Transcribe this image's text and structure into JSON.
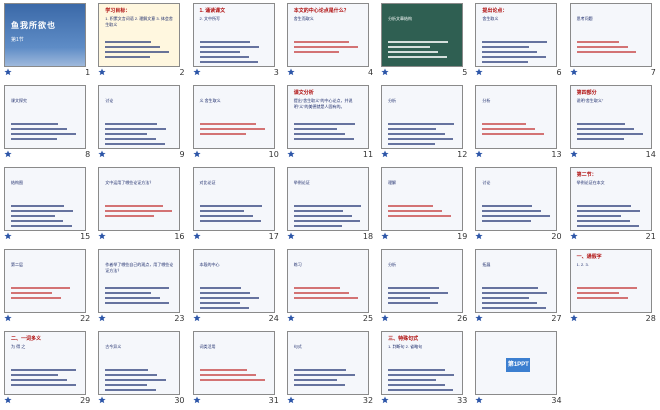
{
  "window": {
    "view": "slide-sorter"
  },
  "colors": {
    "accent": "#c01818",
    "text": "#1b2a6a",
    "thumb_border": "#8a8a8a",
    "title_bg": "#3b69a8",
    "logo_bg": "#3c7fd0"
  },
  "slides": [
    {
      "n": "1",
      "style": "blue",
      "title": "鱼我所欲也",
      "body": "第1节"
    },
    {
      "n": "2",
      "style": "pale",
      "title": "学习目标：",
      "body": "1. 积累文言词语 2. 理解文意 3. 体会舍生取义"
    },
    {
      "n": "3",
      "style": "plain",
      "title": "1. 诵读课文",
      "body": "2. 文中所写"
    },
    {
      "n": "4",
      "style": "plain",
      "title": "本文的中心论点是什么？",
      "body": "舍生而取义"
    },
    {
      "n": "5",
      "style": "green",
      "title": "",
      "body": "分析文章结构"
    },
    {
      "n": "6",
      "style": "plain",
      "title": "提出论点：",
      "body": "舍生取义"
    },
    {
      "n": "7",
      "style": "plain",
      "title": "",
      "body": "思考问题"
    },
    {
      "n": "8",
      "style": "plain",
      "title": "",
      "body": "课文探究"
    },
    {
      "n": "9",
      "style": "plain",
      "title": "",
      "body": "讨论"
    },
    {
      "n": "10",
      "style": "plain",
      "title": "",
      "body": "义 舍生取义"
    },
    {
      "n": "11",
      "style": "plain",
      "title": "课文分析",
      "body": "提出“舍生取义”的中心论点，并说明“义”的美德就是人固有的。"
    },
    {
      "n": "12",
      "style": "plain",
      "title": "",
      "body": "分析"
    },
    {
      "n": "13",
      "style": "plain",
      "title": "",
      "body": "分析"
    },
    {
      "n": "14",
      "style": "plain",
      "title": "第四部分",
      "body": "说明“舍生取义”"
    },
    {
      "n": "15",
      "style": "plain",
      "title": "",
      "body": "结构图"
    },
    {
      "n": "16",
      "style": "plain",
      "title": "",
      "body": "文中运用了哪些论证方法？"
    },
    {
      "n": "17",
      "style": "plain",
      "title": "",
      "body": "对比论证"
    },
    {
      "n": "18",
      "style": "plain",
      "title": "",
      "body": "举例论证"
    },
    {
      "n": "19",
      "style": "plain",
      "title": "",
      "body": "理解"
    },
    {
      "n": "20",
      "style": "plain",
      "title": "",
      "body": "讨论"
    },
    {
      "n": "21",
      "style": "plain",
      "title": "第二节：",
      "body": "举例论证在本文"
    },
    {
      "n": "22",
      "style": "plain",
      "title": "",
      "body": "第二层"
    },
    {
      "n": "23",
      "style": "plain",
      "title": "",
      "body": "作者举了哪些自己的观点，用了哪些论证方法？"
    },
    {
      "n": "24",
      "style": "plain",
      "title": "",
      "body": "本段的中心"
    },
    {
      "n": "25",
      "style": "plain",
      "title": "",
      "body": "练习"
    },
    {
      "n": "26",
      "style": "plain",
      "title": "",
      "body": "分析"
    },
    {
      "n": "27",
      "style": "plain",
      "title": "",
      "body": "拓展"
    },
    {
      "n": "28",
      "style": "plain",
      "title": "一、通假字",
      "body": "1. 2. 3."
    },
    {
      "n": "29",
      "style": "plain",
      "title": "二、一词多义",
      "body": "为 得 之"
    },
    {
      "n": "30",
      "style": "plain",
      "title": "",
      "body": "古今异义"
    },
    {
      "n": "31",
      "style": "plain",
      "title": "",
      "body": "词类活用"
    },
    {
      "n": "32",
      "style": "plain",
      "title": "",
      "body": "句式"
    },
    {
      "n": "33",
      "style": "plain",
      "title": "三、特殊句式",
      "body": "1. 判断句 2. 省略句"
    },
    {
      "n": "34",
      "style": "plain",
      "title": "第1PPT",
      "body": ""
    }
  ]
}
